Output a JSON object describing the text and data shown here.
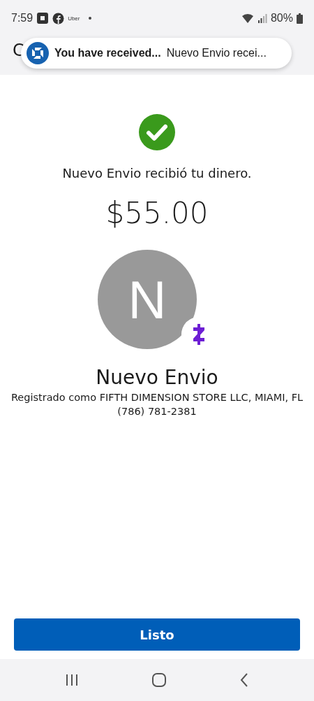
{
  "status_bar": {
    "time": "7:59",
    "app_label": "Uber",
    "battery": "80%"
  },
  "header": {
    "title": "C"
  },
  "notification": {
    "title": "You have received...",
    "text": "Nuevo Envio recei..."
  },
  "confirmation": {
    "message": "Nuevo Envio recibió tu dinero.",
    "amount": "$55.00"
  },
  "recipient": {
    "initial": "N",
    "name": "Nuevo Envio",
    "registered": "Registrado como FIFTH DIMENSION STORE LLC, MIAMI, FL",
    "phone": "(786) 781-2381"
  },
  "button": {
    "label": "Listo"
  }
}
